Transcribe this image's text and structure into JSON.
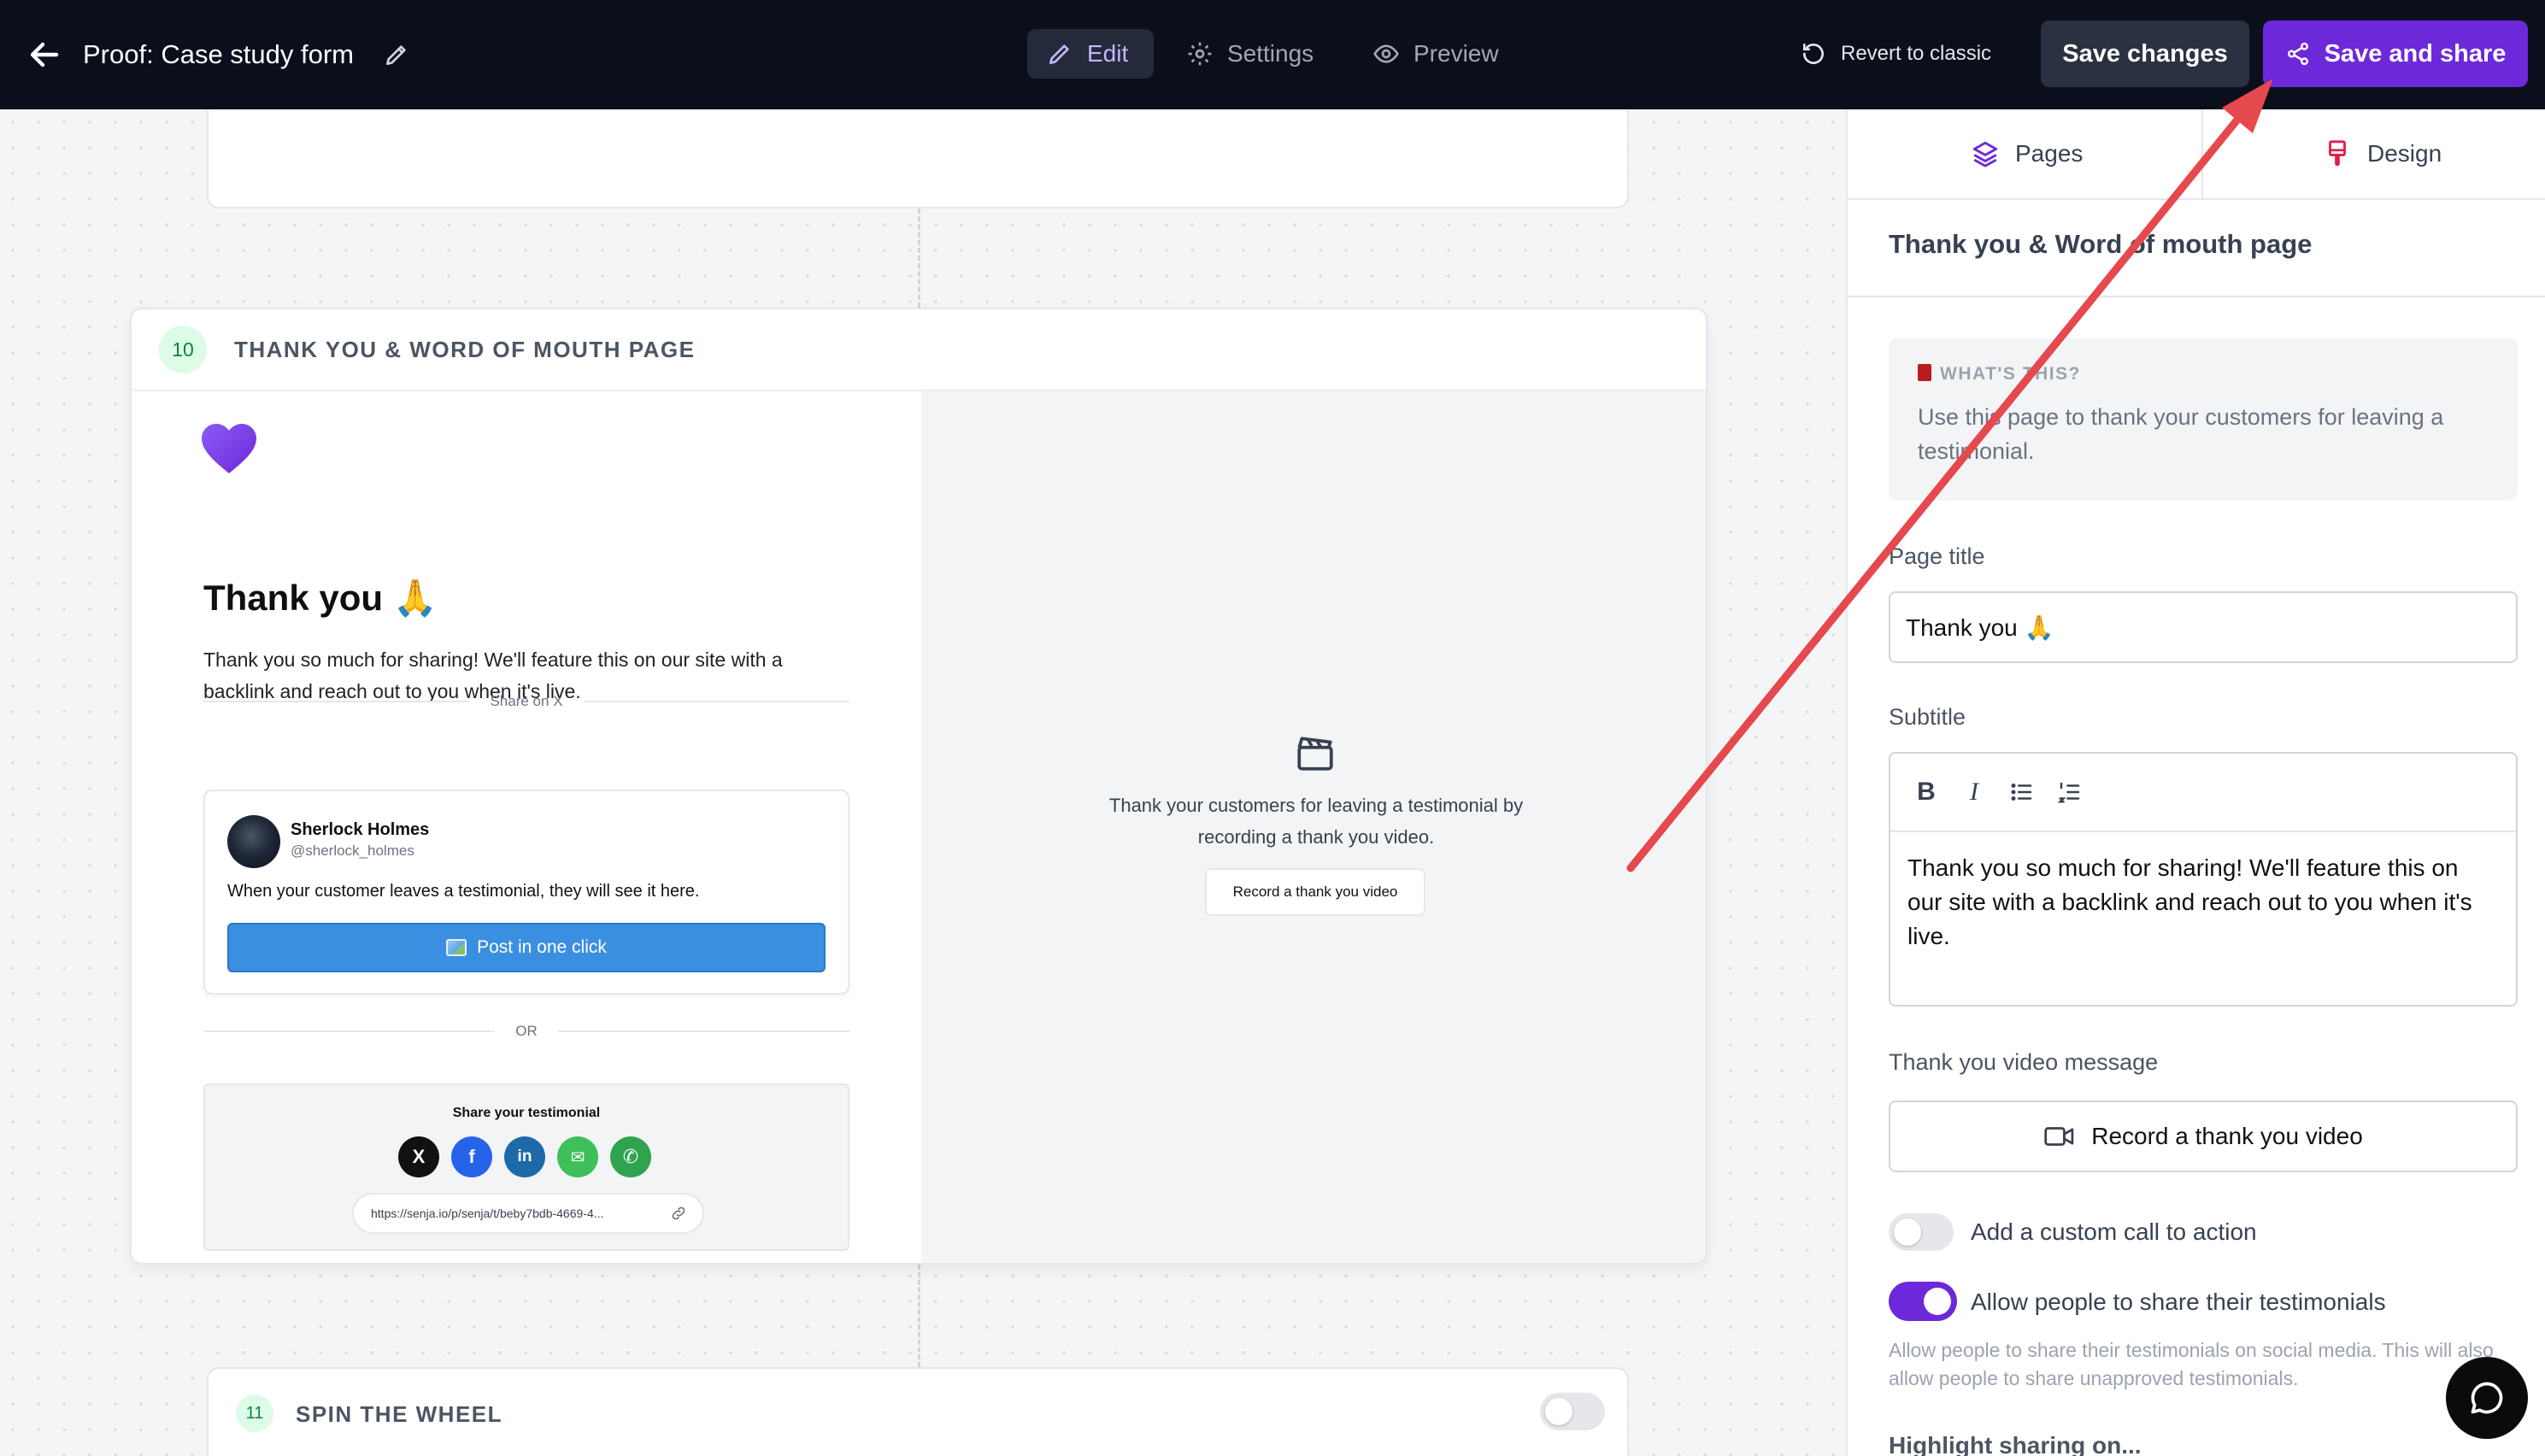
{
  "topbar": {
    "title": "Proof: Case study form",
    "tabs": [
      {
        "label": "Edit",
        "active": true
      },
      {
        "label": "Settings",
        "active": false
      },
      {
        "label": "Preview",
        "active": false
      }
    ],
    "revert_label": "Revert to classic",
    "save_label": "Save changes",
    "share_label": "Save and share"
  },
  "canvas": {
    "page10": {
      "number": "10",
      "title": "THANK YOU & WORD OF MOUTH PAGE",
      "preview": {
        "title": "Thank you",
        "title_emoji": "🙏",
        "subtitle": "Thank you so much for sharing! We'll feature this on our site with a backlink and reach out to you when it's live.",
        "share_on_x": "Share on X",
        "tweet": {
          "name": "Sherlock Holmes",
          "handle": "@sherlock_holmes",
          "text": "When your customer leaves a testimonial, they will see it here.",
          "button": "Post in one click"
        },
        "or_label": "OR",
        "share_box": {
          "title": "Share your testimonial",
          "networks": [
            {
              "icon": "x-icon",
              "glyph": "X",
              "color": "#111111"
            },
            {
              "icon": "facebook-icon",
              "glyph": "f",
              "color": "#2563eb"
            },
            {
              "icon": "linkedin-icon",
              "glyph": "in",
              "color": "#1e6aa8"
            },
            {
              "icon": "message-icon",
              "glyph": "✉",
              "color": "#3fbf5a"
            },
            {
              "icon": "whatsapp-icon",
              "glyph": "✆",
              "color": "#2fa44f"
            }
          ],
          "url": "https://senja.io/p/senja/t/beby7bdb-4669-4..."
        }
      },
      "right": {
        "text": "Thank your customers for leaving a testimonial by recording a thank you video.",
        "button": "Record a thank you video"
      }
    },
    "page11": {
      "number": "11",
      "title": "SPIN THE WHEEL",
      "enabled": false
    }
  },
  "panel": {
    "tabs": [
      {
        "label": "Pages",
        "icon": "layers-icon"
      },
      {
        "label": "Design",
        "icon": "brush-icon"
      }
    ],
    "heading": "Thank you & Word of mouth page",
    "info": {
      "label": "WHAT'S THIS?",
      "text": "Use this page to thank your customers for leaving a testimonial."
    },
    "page_title_label": "Page title",
    "page_title_value": "Thank you 🙏",
    "subtitle_label": "Subtitle",
    "subtitle_value": "Thank you so much for sharing! We'll feature this on our site with a backlink and reach out to you when it's live.",
    "video_label": "Thank you video message",
    "video_button": "Record a thank you video",
    "toggles": [
      {
        "label": "Add a custom call to action",
        "on": false
      },
      {
        "label": "Allow people to share their testimonials",
        "on": true
      }
    ],
    "share_desc": "Allow people to share their testimonials on social media. This will also allow people to share unapproved testimonials.",
    "highlight_label": "Highlight sharing on..."
  },
  "colors": {
    "accent": "#6d28d9",
    "topbar_bg": "#0b0f1c",
    "annotation_arrow": "#e5484d"
  }
}
